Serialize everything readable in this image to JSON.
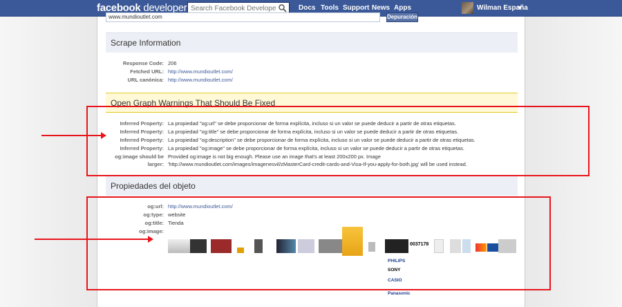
{
  "topbar": {
    "logo_bold": "facebook",
    "logo_light": " developers",
    "search_placeholder": "Search Facebook Developers",
    "nav": [
      "Docs",
      "Tools",
      "Support",
      "News",
      "Apps"
    ],
    "user_name": "Wilman España"
  },
  "url_bar": {
    "value": "www.mundioutlet.com",
    "debug_label": "Depuración"
  },
  "scrape": {
    "title": "Scrape Information",
    "rows": [
      {
        "label": "Response Code:",
        "value": "206"
      },
      {
        "label": "Fetched URL:",
        "value": "http://www.mundioutlet.com/"
      },
      {
        "label": "URL canónica:",
        "value": "http://www.mundioutlet.com/"
      }
    ]
  },
  "warnings": {
    "title": "Open Graph Warnings That Should Be Fixed",
    "rows": [
      {
        "label": "Inferred Property:",
        "value": "La propiedad \"og:url\" se debe proporcionar de forma explícita, incluso si un valor se puede deducir a partir de otras etiquetas."
      },
      {
        "label": "Inferred Property:",
        "value": "La propiedad \"og:title\" se debe proporcionar de forma explícita, incluso si un valor se puede deducir a partir de otras etiquetas."
      },
      {
        "label": "Inferred Property:",
        "value": "La propiedad \"og:description\" se debe proporcionar de forma explícita, incluso si un valor se puede deducir a partir de otras etiquetas."
      },
      {
        "label": "Inferred Property:",
        "value": "La propiedad \"og:image\" se debe proporcionar de forma explícita, incluso si un valor se puede deducir a partir de otras etiquetas."
      },
      {
        "label": "og:image should be larger:",
        "value": "Provided og:image is not big enough. Please use an image that's at least 200x200 px. Image 'http://www.mundioutlet.com/images/imagenesvil/zMasterCard-credit-cards-and-Visa-If-you-apply-for-both.jpg' will be used instead."
      }
    ]
  },
  "object": {
    "title": "Propiedades del objeto",
    "rows": [
      {
        "label": "og:url:",
        "value": "http://www.mundioutlet.com/"
      },
      {
        "label": "og:type:",
        "value": "website"
      },
      {
        "label": "og:title:",
        "value": "Tienda"
      },
      {
        "label": "og:image:",
        "value": ""
      }
    ],
    "brands": [
      "PHILIPS",
      "SONY",
      "CASIO",
      "Panasonic"
    ],
    "thumb_text": "0037178"
  },
  "colors": {
    "facebook_blue": "#3b5998",
    "annotation_red": "#e8141b",
    "warning_bg": "#fff9d7"
  }
}
